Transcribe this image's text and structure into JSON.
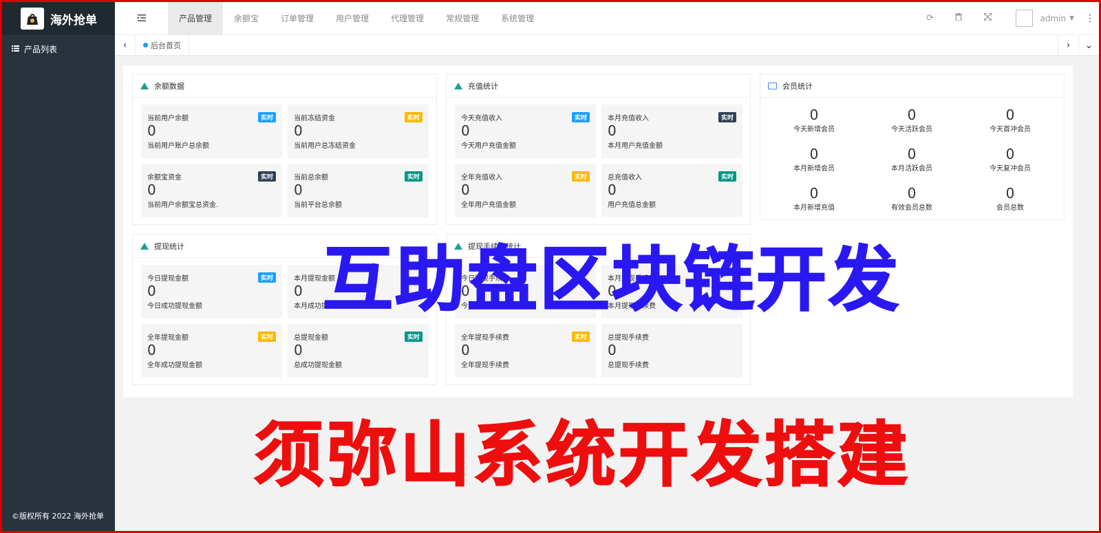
{
  "app": {
    "name": "海外抢单",
    "logo_icon": "bag-logo-icon"
  },
  "sidebar": {
    "items": [
      {
        "label": "产品列表",
        "icon": "list-icon"
      }
    ],
    "copyright": "©版权所有 2022 海外抢单"
  },
  "header": {
    "nav": [
      "产品管理",
      "余额宝",
      "订单管理",
      "用户管理",
      "代理管理",
      "常规管理",
      "系统管理"
    ],
    "active_index": 0,
    "user": "admin"
  },
  "tabs": [
    {
      "label": "后台首页"
    }
  ],
  "cards": {
    "balance": {
      "title": "余额数据",
      "stats": [
        {
          "title": "当前用户余额",
          "value": "0",
          "desc": "当前用户账户总余额",
          "badge": "实时",
          "badge_color": "#1e9fff"
        },
        {
          "title": "当前冻结资金",
          "value": "0",
          "desc": "当前用户总冻结资金",
          "badge": "实时",
          "badge_color": "#ffb800"
        },
        {
          "title": "余额宝资金",
          "value": "0",
          "desc": "当前用户余额宝总资金.",
          "badge": "实时",
          "badge_color": "#2f4056"
        },
        {
          "title": "当前总余额",
          "value": "0",
          "desc": "当前平台总余额",
          "badge": "实时",
          "badge_color": "#009688"
        }
      ]
    },
    "recharge": {
      "title": "充值统计",
      "stats": [
        {
          "title": "今天充值收入",
          "value": "0",
          "desc": "今天用户充值金额",
          "badge": "实时",
          "badge_color": "#1e9fff"
        },
        {
          "title": "本月充值收入",
          "value": "0",
          "desc": "本月用户充值金额",
          "badge": "实时",
          "badge_color": "#2f4056"
        },
        {
          "title": "全年充值收入",
          "value": "0",
          "desc": "全年用户充值金额",
          "badge": "实时",
          "badge_color": "#ffb800"
        },
        {
          "title": "总充值收入",
          "value": "0",
          "desc": "用户充值总金额",
          "badge": "实时",
          "badge_color": "#009688"
        }
      ]
    },
    "members": {
      "title": "会员统计",
      "items": [
        {
          "value": "0",
          "label": "今天新增会员"
        },
        {
          "value": "0",
          "label": "今天活跃会员"
        },
        {
          "value": "0",
          "label": "今天首冲会员"
        },
        {
          "value": "0",
          "label": "本月新增会员"
        },
        {
          "value": "0",
          "label": "本月活跃会员"
        },
        {
          "value": "0",
          "label": "今天复冲会员"
        },
        {
          "value": "0",
          "label": "本月新增充值"
        },
        {
          "value": "0",
          "label": "有效会员总数"
        },
        {
          "value": "0",
          "label": "会员总数"
        }
      ]
    },
    "withdraw": {
      "title": "提现统计",
      "stats": [
        {
          "title": "今日提现金额",
          "value": "0",
          "desc": "今日成功提现金额",
          "badge": "实时",
          "badge_color": "#1e9fff"
        },
        {
          "title": "本月提现金额",
          "value": "0",
          "desc": "本月成功提现金额",
          "badge": "",
          "badge_color": "#2f4056"
        },
        {
          "title": "全年提现金额",
          "value": "0",
          "desc": "全年成功提现金额",
          "badge": "实时",
          "badge_color": "#ffb800"
        },
        {
          "title": "总提现金额",
          "value": "0",
          "desc": "总成功提现金额",
          "badge": "实时",
          "badge_color": "#009688"
        }
      ]
    },
    "fee": {
      "title": "提现手续费统计",
      "stats": [
        {
          "title": "今日提现手续费",
          "value": "0",
          "desc": "今日提现手续费",
          "badge": "",
          "badge_color": "#1e9fff"
        },
        {
          "title": "本月提现手续费",
          "value": "0",
          "desc": "本月提现手续费",
          "badge": "",
          "badge_color": "#2f4056"
        },
        {
          "title": "全年提现手续费",
          "value": "0",
          "desc": "全年提现手续费",
          "badge": "实时",
          "badge_color": "#ffb800"
        },
        {
          "title": "总提现手续费",
          "value": "0",
          "desc": "总提现手续费",
          "badge": "",
          "badge_color": "#009688"
        }
      ]
    }
  },
  "overlay": {
    "line1": "互助盘区块链开发",
    "line2": "须弥山系统开发搭建"
  }
}
